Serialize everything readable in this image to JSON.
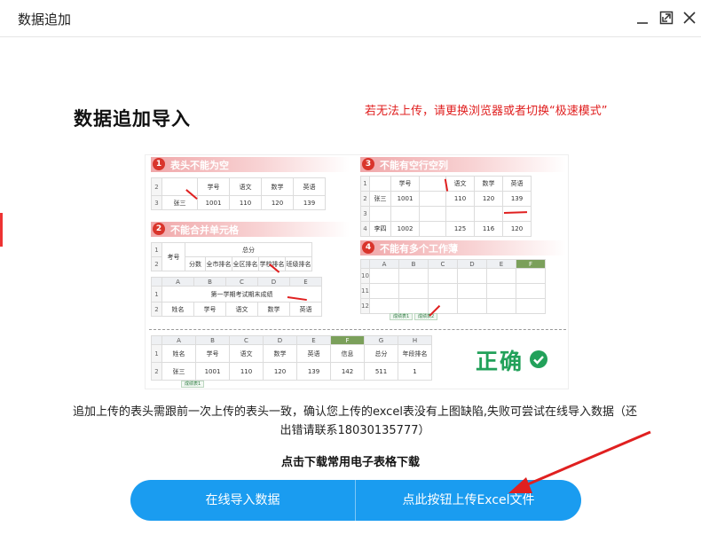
{
  "window": {
    "title": "数据追加"
  },
  "heading": "数据追加导入",
  "warning": "若无法上传，请更换浏览器或者切换“极速模式”",
  "guide": {
    "sections": [
      {
        "num": "1",
        "title": "表头不能为空"
      },
      {
        "num": "2",
        "title": "不能合并单元格"
      },
      {
        "num": "3",
        "title": "不能有空行空列"
      },
      {
        "num": "4",
        "title": "不能有多个工作薄"
      }
    ],
    "s1": {
      "headers": [
        "",
        "学号",
        "语文",
        "数学",
        "英语"
      ],
      "row": [
        "张三",
        "1001",
        "110",
        "120",
        "139"
      ],
      "rownums": [
        "2",
        "3"
      ]
    },
    "s2a": {
      "top": [
        "考号",
        "总分"
      ],
      "sub": [
        "分数",
        "全市排名",
        "全区排名",
        "学校排名",
        "班级排名"
      ],
      "rownums": [
        "1",
        "2"
      ]
    },
    "s2b": {
      "cols": [
        "A",
        "B",
        "C",
        "D",
        "E"
      ],
      "merged": "第一学期考试期末成绩",
      "row": [
        "姓名",
        "学号",
        "语文",
        "数学",
        "英语"
      ],
      "rownums": [
        "1",
        "2"
      ]
    },
    "s3": {
      "headers": [
        "学号",
        "",
        "语文",
        "数学",
        "英语"
      ],
      "rows": [
        [
          "张三",
          "1001",
          "",
          "110",
          "120",
          "139"
        ],
        [
          "",
          "",
          "",
          "",
          "",
          ""
        ],
        [
          "李四",
          "1002",
          "",
          "125",
          "116",
          "120"
        ]
      ],
      "rownums": [
        "1",
        "2",
        "3",
        "4"
      ]
    },
    "s4": {
      "cols": [
        "A",
        "B",
        "C",
        "D",
        "E",
        "F"
      ],
      "rownums": [
        "10",
        "11",
        "12"
      ],
      "tabs": [
        "成绩表1",
        "成绩表2"
      ]
    },
    "good": {
      "cols": [
        "A",
        "B",
        "C",
        "D",
        "E",
        "F",
        "G",
        "H"
      ],
      "headers": [
        "姓名",
        "学号",
        "语文",
        "数学",
        "英语",
        "信息",
        "总分",
        "年段排名"
      ],
      "row": [
        "张三",
        "1001",
        "110",
        "120",
        "139",
        "142",
        "511",
        "1"
      ],
      "rownums": [
        "1",
        "2"
      ],
      "tab": "成绩表1",
      "label": "正确"
    }
  },
  "description": "追加上传的表头需跟前一次上传的表头一致，确认您上传的excel表没有上图缺陷,失败可尝试在线导入数据（还出错请联系18030135777）",
  "download_link": "点击下载常用电子表格下载",
  "buttons": {
    "online_import": "在线导入数据",
    "upload_excel": "点此按钮上传Excel文件"
  },
  "colors": {
    "primary": "#1a9cf0",
    "warning": "#e02020",
    "correct": "#22a15a"
  }
}
